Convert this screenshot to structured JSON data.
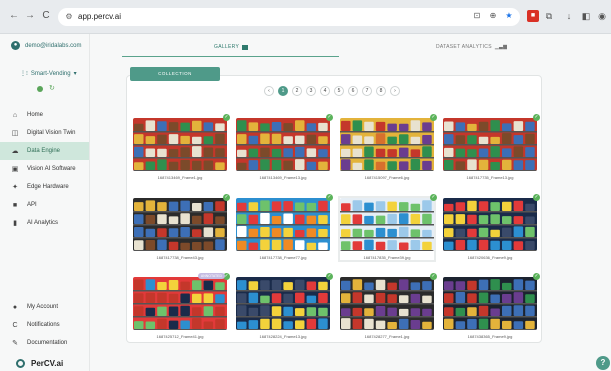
{
  "browser": {
    "url": "app.percv.ai",
    "controls": {
      "back": "←",
      "forward": "→",
      "reload": "C"
    }
  },
  "user": {
    "email": "demo@iridalabs.com"
  },
  "workspace": {
    "name": "Smart-Vending"
  },
  "sidebar": {
    "items": [
      {
        "label": "Home",
        "icon": "home-icon",
        "glyph": "⌂"
      },
      {
        "label": "Digital Vision Twin",
        "icon": "twin-icon",
        "glyph": "◫"
      },
      {
        "label": "Data Engine",
        "icon": "data-engine-icon",
        "glyph": "☁",
        "active": true
      },
      {
        "label": "Vision AI Software",
        "icon": "software-icon",
        "glyph": "▣"
      },
      {
        "label": "Edge Hardware",
        "icon": "edge-icon",
        "glyph": "✦"
      },
      {
        "label": "API",
        "icon": "api-icon",
        "glyph": "■"
      },
      {
        "label": "AI Analytics",
        "icon": "analytics-icon",
        "glyph": "▮"
      }
    ],
    "bottom": [
      {
        "label": "My Account",
        "icon": "account-icon",
        "glyph": "●"
      },
      {
        "label": "Notifications",
        "icon": "notification-icon",
        "glyph": "C"
      },
      {
        "label": "Documentation",
        "icon": "documentation-icon",
        "glyph": "✎"
      }
    ],
    "logo": "PerCV.ai"
  },
  "tabs": {
    "gallery": "GALLERY",
    "dataset": "DATASET ANALYTICS"
  },
  "collection_button": "COLLECTION",
  "pagination": {
    "prev": "‹",
    "next": "›",
    "pages": [
      "1",
      "2",
      "3",
      "4",
      "5",
      "6",
      "7",
      "8"
    ],
    "current": "1"
  },
  "gallery": [
    {
      "caption": "1687413469_Frame1.jpg",
      "style": "snacks"
    },
    {
      "caption": "1687413469_Frame13.jpg",
      "style": "snacks"
    },
    {
      "caption": "1687415097_Frame6.jpg",
      "style": "snacks-dense"
    },
    {
      "caption": "1687417735_Frame13.jpg",
      "style": "snacks"
    },
    {
      "caption": "1687417738_Frame43.jpg",
      "style": "snacks-shelf"
    },
    {
      "caption": "1687417738_Frame77.jpg",
      "style": "bottles"
    },
    {
      "caption": "1687417835_Frame39.jpg",
      "style": "bottles-bright",
      "selected": true
    },
    {
      "caption": "1687420636_Frame9.jpg",
      "style": "bottles-dark"
    },
    {
      "caption": "1687425712_Frame41.jpg",
      "style": "cans",
      "tag": "ANNOTATED"
    },
    {
      "caption": "1687428224_Frame13.jpg",
      "style": "bottles-dark"
    },
    {
      "caption": "1687428277_Frame1.jpg",
      "style": "snacks-mixed"
    },
    {
      "caption": "1687438365_Frame9.jpg",
      "style": "snacks-dark"
    }
  ],
  "help_label": "?"
}
